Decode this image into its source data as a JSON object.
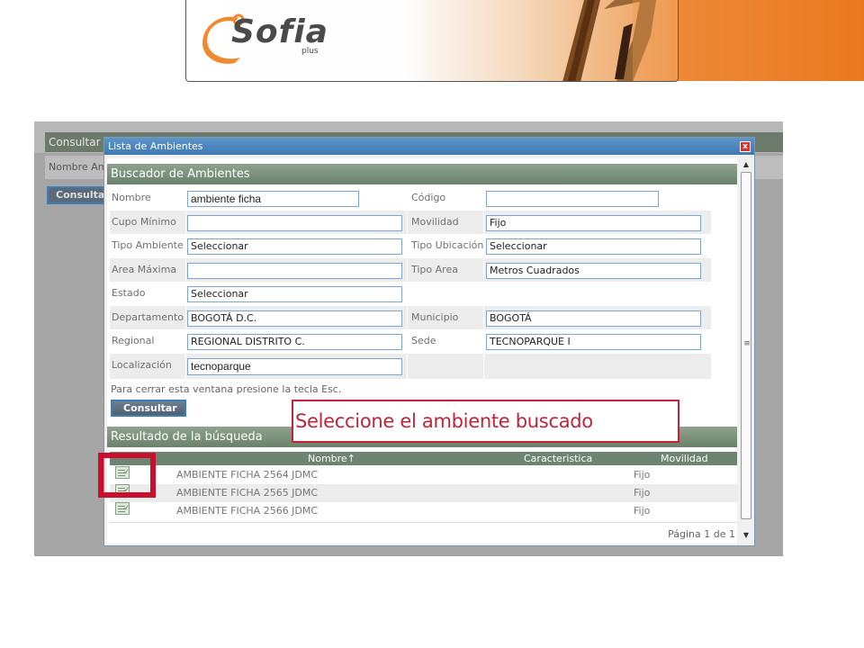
{
  "banner": {
    "logo_text": "Sofia",
    "logo_subtext": "plus"
  },
  "background_app": {
    "header_label": "Consultar",
    "row_label": "Nombre Am",
    "button_label": "Consulta"
  },
  "dialog": {
    "title": "Lista de Ambientes",
    "close_label": "x",
    "search_section_title": "Buscador de Ambientes",
    "fields": {
      "nombre": {
        "label": "Nombre",
        "value": "ambiente ficha"
      },
      "codigo": {
        "label": "Código",
        "value": ""
      },
      "cupo_minimo": {
        "label": "Cupo Mínimo",
        "value": ""
      },
      "movilidad": {
        "label": "Movilidad",
        "value": "Fijo"
      },
      "tipo_ambiente": {
        "label": "Tipo Ambiente",
        "value": "Seleccionar"
      },
      "tipo_ubicacion": {
        "label": "Tipo Ubicación",
        "value": "Seleccionar"
      },
      "area_maxima": {
        "label": "Area Máxima",
        "value": ""
      },
      "tipo_area": {
        "label": "Tipo Area",
        "value": "Metros Cuadrados"
      },
      "estado": {
        "label": "Estado",
        "value": "Seleccionar"
      },
      "departamento": {
        "label": "Departamento",
        "value": "BOGOTÁ D.C."
      },
      "municipio": {
        "label": "Municipio",
        "value": "BOGOTÁ"
      },
      "regional": {
        "label": "Regional",
        "value": "REGIONAL DISTRITO C."
      },
      "sede": {
        "label": "Sede",
        "value": "TECNOPARQUE I"
      },
      "localizacion": {
        "label": "Localización",
        "value": "tecnoparque"
      }
    },
    "esc_note": "Para cerrar esta ventana presione la tecla Esc.",
    "consultar_button": "Consultar",
    "results_section_title": "Resultado de la búsqueda",
    "results": {
      "columns": [
        "Nombre↑",
        "Caracteristica",
        "Movilidad"
      ],
      "rows": [
        {
          "nombre": "AMBIENTE FICHA 2564 JDMC",
          "caracteristica": "",
          "movilidad": "Fijo"
        },
        {
          "nombre": "AMBIENTE FICHA 2565 JDMC",
          "caracteristica": "",
          "movilidad": "Fijo"
        },
        {
          "nombre": "AMBIENTE FICHA 2566 JDMC",
          "caracteristica": "",
          "movilidad": "Fijo"
        }
      ],
      "pager": "Página 1 de 1"
    }
  },
  "annotation": {
    "callout_text": "Seleccione el ambiente buscado"
  },
  "colors": {
    "accent_orange": "#e9791f",
    "section_green": "#6a816a",
    "dialog_title_blue": "#3d79b2",
    "annotation_red": "#c0243a"
  }
}
